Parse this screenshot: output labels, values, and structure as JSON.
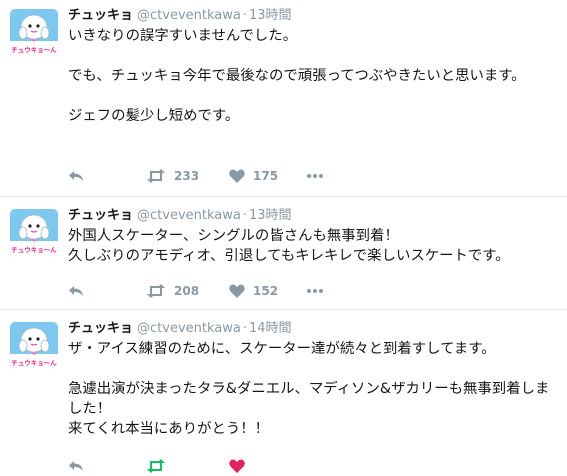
{
  "tweets": [
    {
      "name": "チュッキョ",
      "handle": "@ctveventkawa",
      "separator": "·",
      "time": "13時間",
      "text": "いきなりの誤字すいませんでした。\n\nでも、チュッキョ今年で最後なので頑張ってつぶやきたいと思います。\n\nジェフの髪少し短めです。",
      "retweets": "233",
      "likes": "175"
    },
    {
      "name": "チュッキョ",
      "handle": "@ctveventkawa",
      "separator": "·",
      "time": "13時間",
      "text": "外国人スケーター、シングルの皆さんも無事到着！\n久しぶりのアモディオ、引退してもキレキレで楽しいスケートです。",
      "retweets": "208",
      "likes": "152"
    },
    {
      "name": "チュッキョ",
      "handle": "@ctveventkawa",
      "separator": "·",
      "time": "14時間",
      "text": "ザ・アイス練習のために、スケーター達が続々と到着すしてます。\n\n急遽出演が決まったタラ&ダニエル、マディソン&ザカリーも無事到着しました！\n来てくれ本当にありがとう！！",
      "retweets": "",
      "likes": ""
    }
  ],
  "avatar": {
    "caption": "チュウキョ～ん",
    "colors": {
      "sky": "#7ec8ef",
      "body": "#ffffff",
      "caption": "#e8278a",
      "ribbon": "#f07ab8"
    }
  },
  "icons": [
    "reply-icon",
    "retweet-icon",
    "heart-icon",
    "more-icon"
  ],
  "colors": {
    "text": "#14171a",
    "muted": "#8899a6",
    "divider": "#e6ecf0",
    "like_accent": "#e0245e",
    "retweet_accent": "#17bf63"
  }
}
